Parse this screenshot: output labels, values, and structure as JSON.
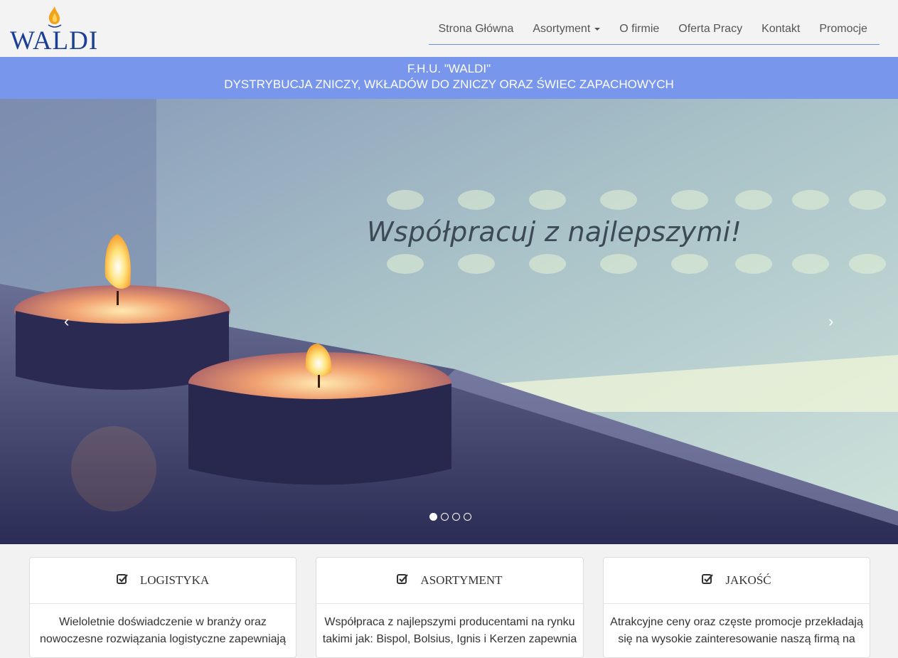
{
  "brand": {
    "logo_text": "WALDI"
  },
  "nav": {
    "items": [
      {
        "label": "Strona Główna"
      },
      {
        "label": "Asortyment"
      },
      {
        "label": "O firmie"
      },
      {
        "label": "Oferta Pracy"
      },
      {
        "label": "Kontakt"
      },
      {
        "label": "Promocje"
      }
    ]
  },
  "banner": {
    "line1": "F.H.U. \"WALDI\"",
    "line2": "DYSTRYBUCJA ZNICZY, WKŁADÓW DO ZNICZY ORAZ ŚWIEC ZAPACHOWYCH"
  },
  "carousel": {
    "caption": "Współpracuj z najlepszymi!",
    "prev_icon": "‹",
    "next_icon": "›",
    "slide_count": 4,
    "active_slide": 1
  },
  "cards": [
    {
      "title": "LOGISTYKA",
      "icon": "check-square-icon",
      "text1": "Wieloletnie doświadczenie w branży oraz",
      "text2": "nowoczesne rozwiązania logistyczne zapewniają"
    },
    {
      "title": "ASORTYMENT",
      "icon": "check-square-icon",
      "text1": "Współpraca z najlepszymi producentami na rynku",
      "text2": "takimi jak: Bispol, Bolsius, Ignis i Kerzen zapewnia"
    },
    {
      "title": "JAKOŚĆ",
      "icon": "check-square-icon",
      "text1": "Atrakcyjne ceny oraz częste promocje przekładają",
      "text2": "się na wysokie zainteresowanie naszą firmą na"
    }
  ],
  "colors": {
    "nav_underline": "#6d8ce8",
    "banner_bg": "#7896ec",
    "logo_blue": "#1b3f95",
    "flame": "#f2a31b"
  }
}
